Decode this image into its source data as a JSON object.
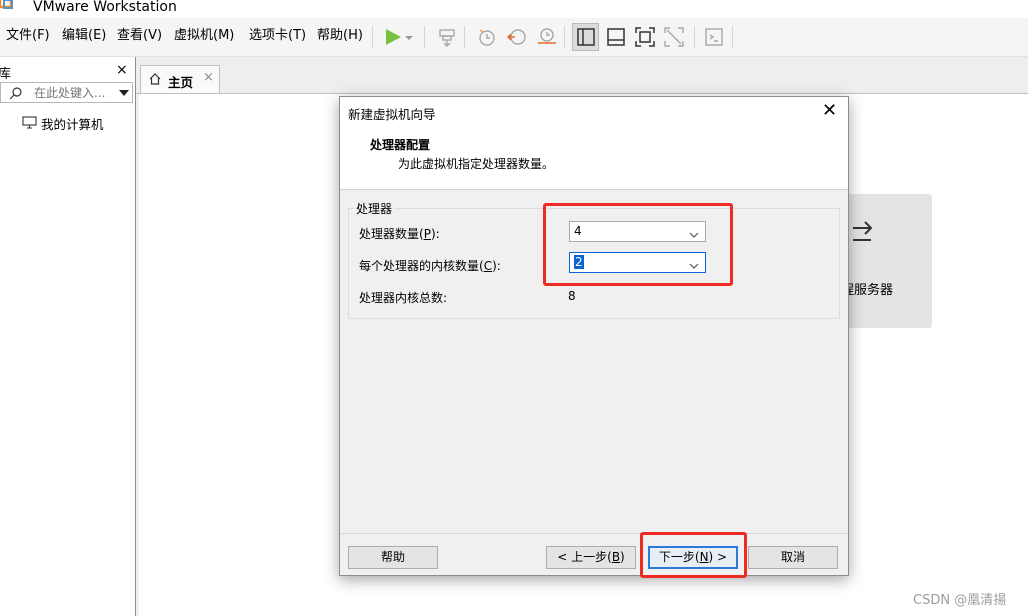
{
  "app": {
    "title": "VMware Workstation"
  },
  "menu": {
    "file": "文件(F)",
    "edit": "编辑(E)",
    "view": "查看(V)",
    "vm": "虚拟机(M)",
    "tabs": "选项卡(T)",
    "help": "帮助(H)"
  },
  "toolbar": {
    "icons": [
      "play-icon",
      "dropdown-icon",
      "send-ctrl-alt-del-icon",
      "snapshot-icon",
      "revert-snapshot-icon",
      "snapshot-manager-icon",
      "library-view-icon",
      "thumbnail-bar-icon",
      "fullscreen-icon",
      "unity-icon",
      "console-icon"
    ],
    "active_color": "#7ac143"
  },
  "sidebar": {
    "title": "库",
    "close": "×",
    "search_placeholder": "在此处键入...",
    "items": [
      {
        "label": "我的计算机",
        "icon": "computer-icon"
      }
    ]
  },
  "tabs": [
    {
      "label": "主页",
      "icon": "home-icon",
      "close": "×"
    }
  ],
  "background": {
    "card_label": "程服务器"
  },
  "dialog": {
    "title": "新建虚拟机向导",
    "close": "✕",
    "heading": "处理器配置",
    "subheading": "为此虚拟机指定处理器数量。",
    "group_label": "处理器",
    "fields": {
      "cpu_count_label_pre": "处理器数量(",
      "cpu_count_label_key": "P",
      "cpu_count_label_post": "):",
      "cpu_count_value": "4",
      "cores_label_pre": "每个处理器的内核数量(",
      "cores_label_key": "C",
      "cores_label_post": "):",
      "cores_value": "2",
      "total_label": "处理器内核总数:",
      "total_value": "8"
    },
    "buttons": {
      "help": "帮助",
      "back_pre": "< 上一步(",
      "back_key": "B",
      "back_post": ")",
      "next_pre": "下一步(",
      "next_key": "N",
      "next_post": ") >",
      "cancel": "取消"
    }
  },
  "highlight_color": "#ee2a24",
  "watermark": "CSDN @凰清揚"
}
